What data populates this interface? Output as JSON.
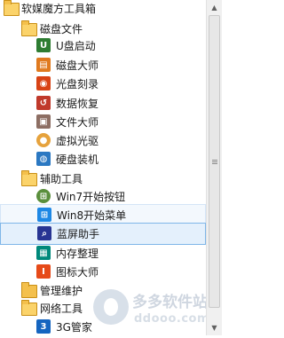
{
  "tree": {
    "root": {
      "label": "软媒魔方工具箱"
    },
    "folders": {
      "disk": {
        "label": "磁盘文件"
      },
      "assist": {
        "label": "辅助工具"
      },
      "maintain": {
        "label": "管理维护"
      },
      "network": {
        "label": "网络工具"
      }
    },
    "items": {
      "usb_boot": {
        "label": "U盘启动",
        "icon": "usb-icon",
        "color": "#2e7d32"
      },
      "disk_master": {
        "label": "磁盘大师",
        "icon": "disk-icon",
        "color": "#e07a1f"
      },
      "cd_burn": {
        "label": "光盘刻录",
        "icon": "flame-icon",
        "color": "#d84315"
      },
      "data_recovery": {
        "label": "数据恢复",
        "icon": "recovery-icon",
        "color": "#c0392b"
      },
      "file_master": {
        "label": "文件大师",
        "icon": "file-icon",
        "color": "#8d6e63"
      },
      "virtual_drive": {
        "label": "虚拟光驱",
        "icon": "disc-icon",
        "color": "#e6a23c"
      },
      "disk_install": {
        "label": "硬盘装机",
        "icon": "install-icon",
        "color": "#2b78c2"
      },
      "win7_start": {
        "label": "Win7开始按钮",
        "icon": "win7-icon",
        "color": "#5a8f3c"
      },
      "win8_menu": {
        "label": "Win8开始菜单",
        "icon": "win8-icon",
        "color": "#1e88e5"
      },
      "bluescreen": {
        "label": "蓝屏助手",
        "icon": "magnifier-icon",
        "color": "#283593"
      },
      "memory": {
        "label": "内存整理",
        "icon": "memory-icon",
        "color": "#00897b"
      },
      "icon_master": {
        "label": "图标大师",
        "icon": "icon-master-icon",
        "color": "#e64a19"
      },
      "g3_manager": {
        "label": "3G管家",
        "icon": "g3-icon",
        "color": "#1565c0"
      }
    }
  },
  "watermark": {
    "title": "多多软件站",
    "url": "ddooo.com"
  }
}
